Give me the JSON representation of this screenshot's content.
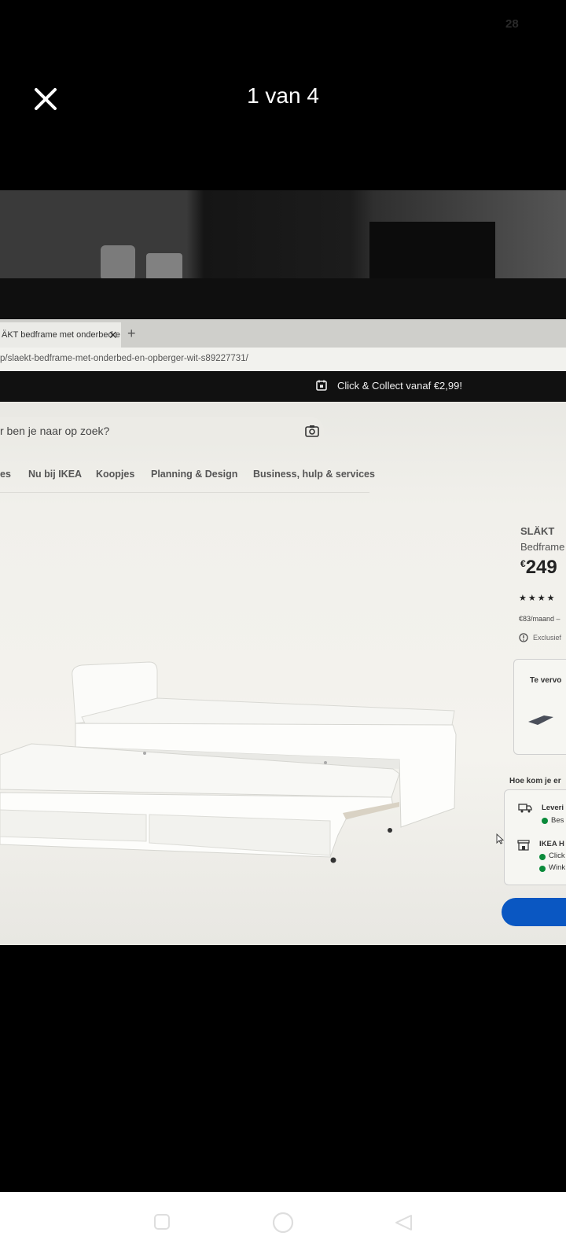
{
  "status": {
    "number": "28"
  },
  "viewer": {
    "counter": "1 van 4",
    "close_icon": "close-icon"
  },
  "browser": {
    "tab_title": "ÄKT bedframe met onderbed e",
    "tab_close": "✕",
    "tab_new": "+",
    "url": "p/slaekt-bedframe-met-onderbed-en-opberger-wit-s89227731/"
  },
  "site": {
    "promo": "Click & Collect vanaf €2,99!",
    "search_placeholder": "r ben je naar op zoek?",
    "nav": [
      "es",
      "Nu bij IKEA",
      "Koopjes",
      "Planning & Design",
      "Business, hulp & services"
    ]
  },
  "product": {
    "brand": "SLÄKT",
    "name": "Bedframe",
    "currency": "€",
    "price": "249",
    "stars": "★★★★",
    "monthly": "€83/maand –",
    "excl": "Exclusief",
    "compare_label": "Te vervo",
    "how": "Hoe kom je er",
    "delivery_title": "Leveri",
    "delivery_sub": "Bes",
    "store_title": "IKEA H",
    "store_line1": "Click",
    "store_line2": "Wink",
    "status_color": "#0a8a3a",
    "accent": "#0a57c2"
  },
  "navbar": {
    "recent_icon": "recent-apps-icon",
    "home_icon": "home-icon",
    "back_icon": "back-icon"
  }
}
